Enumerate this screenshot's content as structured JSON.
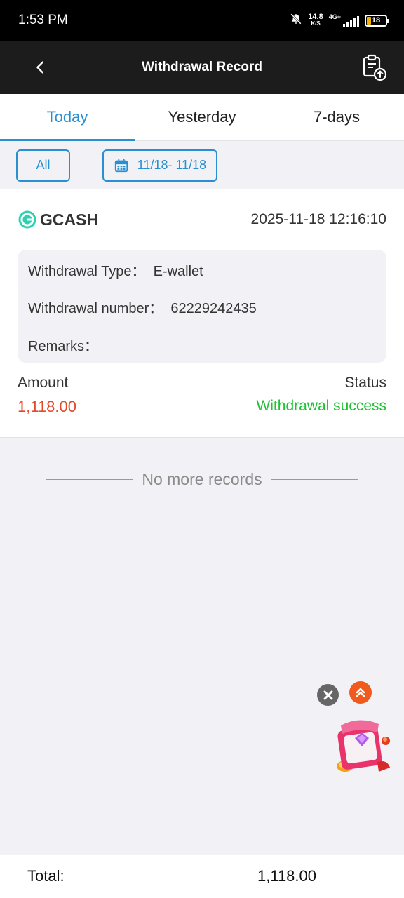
{
  "status_bar": {
    "time": "1:53 PM",
    "net_speed_value": "14.8",
    "net_speed_unit": "K/S",
    "network": "4G+",
    "battery": "18",
    "icons": [
      "bell-muted-icon",
      "signal-icon",
      "battery-icon"
    ]
  },
  "header": {
    "title": "Withdrawal Record",
    "back_icon": "chevron-left-icon",
    "export_icon": "clipboard-upload-icon"
  },
  "tabs": [
    {
      "label": "Today",
      "active": true
    },
    {
      "label": "Yesterday",
      "active": false
    },
    {
      "label": "7-days",
      "active": false
    }
  ],
  "filters": {
    "all_label": "All",
    "date_range": "11/18- 11/18",
    "date_icon": "calendar-icon"
  },
  "record": {
    "method": "GCASH",
    "method_icon": "gcash-logo-icon",
    "datetime": "2025-11-18 12:16:10",
    "type_line": "Withdrawal Type：  E-wallet",
    "number_line": "Withdrawal number：  62229242435",
    "remarks_line": "Remarks：",
    "amount_label": "Amount",
    "amount_value": "1,118.00",
    "status_label": "Status",
    "status_value": "Withdrawal success"
  },
  "list_end_text": "No more records",
  "floating": {
    "close_icon": "close-icon",
    "scroll_top_icon": "double-chevron-up-icon",
    "promo_icon": "gift-box-icon"
  },
  "footer": {
    "total_label": "Total:",
    "total_value": "1,118.00"
  },
  "colors": {
    "accent_blue": "#2a8fd1",
    "amount_red": "#e24a2a",
    "success_green": "#1ec232",
    "header_bg": "#1c1c1c"
  }
}
